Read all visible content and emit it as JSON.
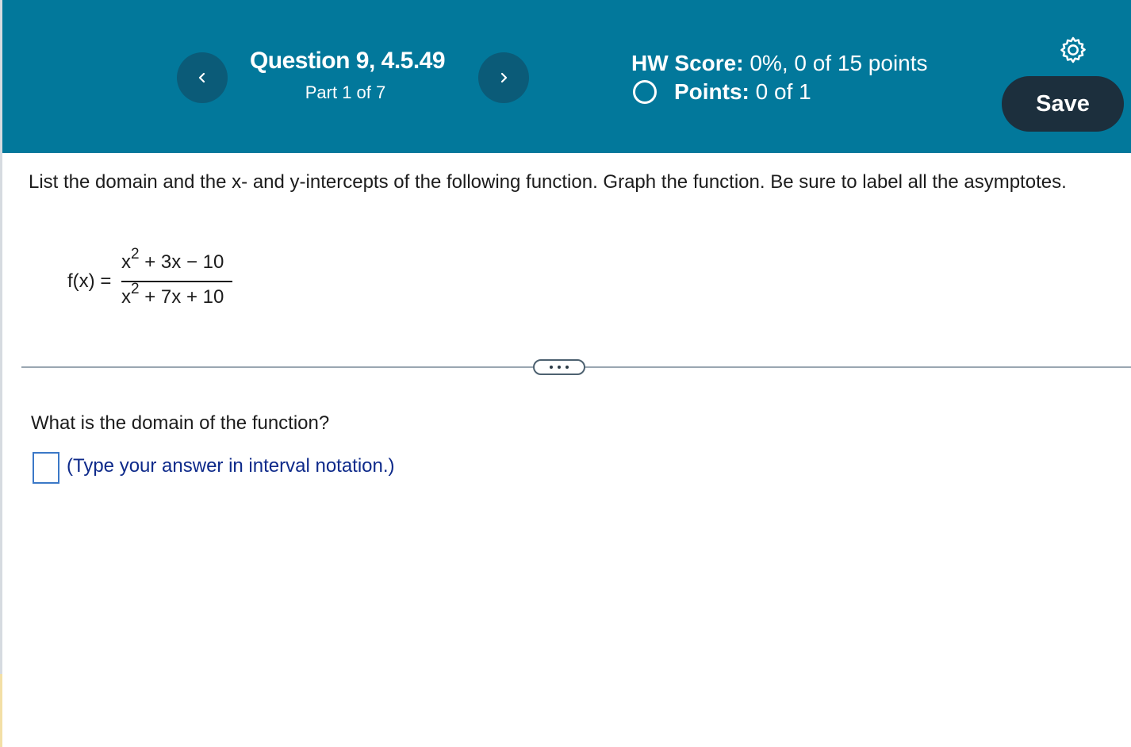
{
  "header": {
    "prev_icon": "chevron-left-icon",
    "next_icon": "chevron-right-icon",
    "question_title": "Question 9, 4.5.49",
    "part_label": "Part 1 of 7",
    "hw_score_label": "HW Score:",
    "hw_score_value": "0%, 0 of 15 points",
    "points_label": "Points:",
    "points_value": "0 of 1",
    "settings_icon": "gear-icon",
    "save_label": "Save",
    "colors": {
      "header_bg": "#02789b",
      "nav_button_bg": "#0b5b78",
      "save_button_bg": "#1c2f3d"
    }
  },
  "question": {
    "text": "List the domain and the x- and y-intercepts of the following function. Graph the function. Be sure to label all the asymptotes.",
    "function_label": "f(x) =",
    "numerator_base": "x",
    "numerator_exp": "2",
    "numerator_rest": " + 3x − 10",
    "denominator_base": "x",
    "denominator_exp": "2",
    "denominator_rest": " + 7x + 10"
  },
  "divider": {
    "more_icon": "ellipsis-icon"
  },
  "part": {
    "prompt": "What is the domain of the function?",
    "answer_value": "",
    "hint": "(Type your answer in interval notation.)"
  }
}
